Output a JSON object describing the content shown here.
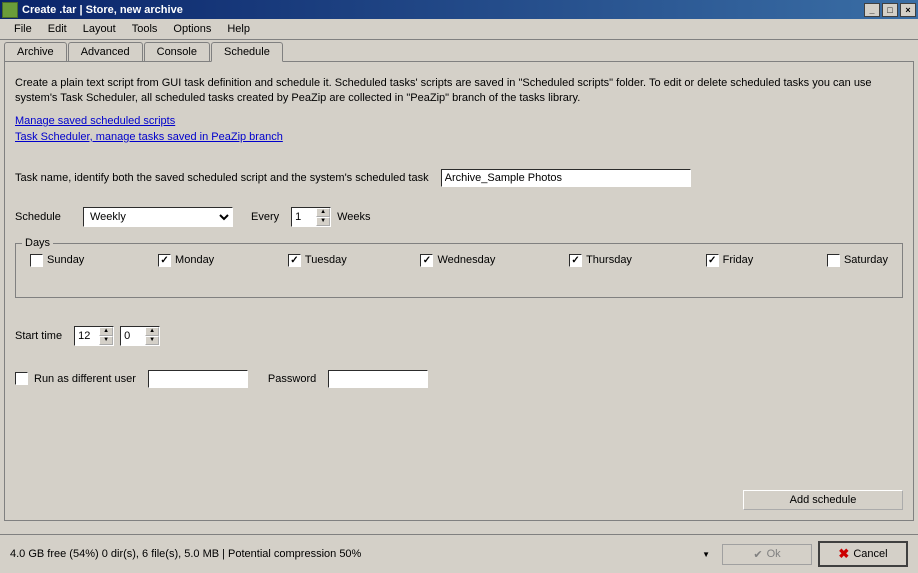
{
  "title": "Create .tar | Store, new archive",
  "menu": [
    "File",
    "Edit",
    "Layout",
    "Tools",
    "Options",
    "Help"
  ],
  "tabs": [
    "Archive",
    "Advanced",
    "Console",
    "Schedule"
  ],
  "active_tab": "Schedule",
  "description": "Create a plain text script from GUI task definition and schedule it. Scheduled tasks' scripts are saved in \"Scheduled scripts\" folder. To edit or delete scheduled tasks you can use system's Task Scheduler, all scheduled tasks created by PeaZip are collected in \"PeaZip\" branch of the tasks library.",
  "links": {
    "manage_scripts": "Manage saved scheduled scripts",
    "task_scheduler": "Task Scheduler, manage tasks saved in PeaZip branch"
  },
  "task_name_label": "Task name, identify both the saved scheduled script and the system's scheduled task",
  "task_name_value": "Archive_Sample Photos",
  "schedule": {
    "label": "Schedule",
    "type": "Weekly",
    "every_label": "Every",
    "every_value": "1",
    "unit": "Weeks"
  },
  "days": {
    "legend": "Days",
    "items": [
      {
        "label": "Sunday",
        "checked": false
      },
      {
        "label": "Monday",
        "checked": true
      },
      {
        "label": "Tuesday",
        "checked": true
      },
      {
        "label": "Wednesday",
        "checked": true
      },
      {
        "label": "Thursday",
        "checked": true
      },
      {
        "label": "Friday",
        "checked": true
      },
      {
        "label": "Saturday",
        "checked": false
      }
    ]
  },
  "start_time": {
    "label": "Start time",
    "hour": "12",
    "minute": "0"
  },
  "run_as": {
    "label": "Run as different user",
    "checked": false,
    "user_value": "",
    "password_label": "Password",
    "password_value": ""
  },
  "add_schedule_btn": "Add schedule",
  "status_text": "4.0 GB free (54%)    0 dir(s), 6 file(s), 5.0 MB | Potential compression 50%",
  "ok_btn": "Ok",
  "cancel_btn": "Cancel"
}
